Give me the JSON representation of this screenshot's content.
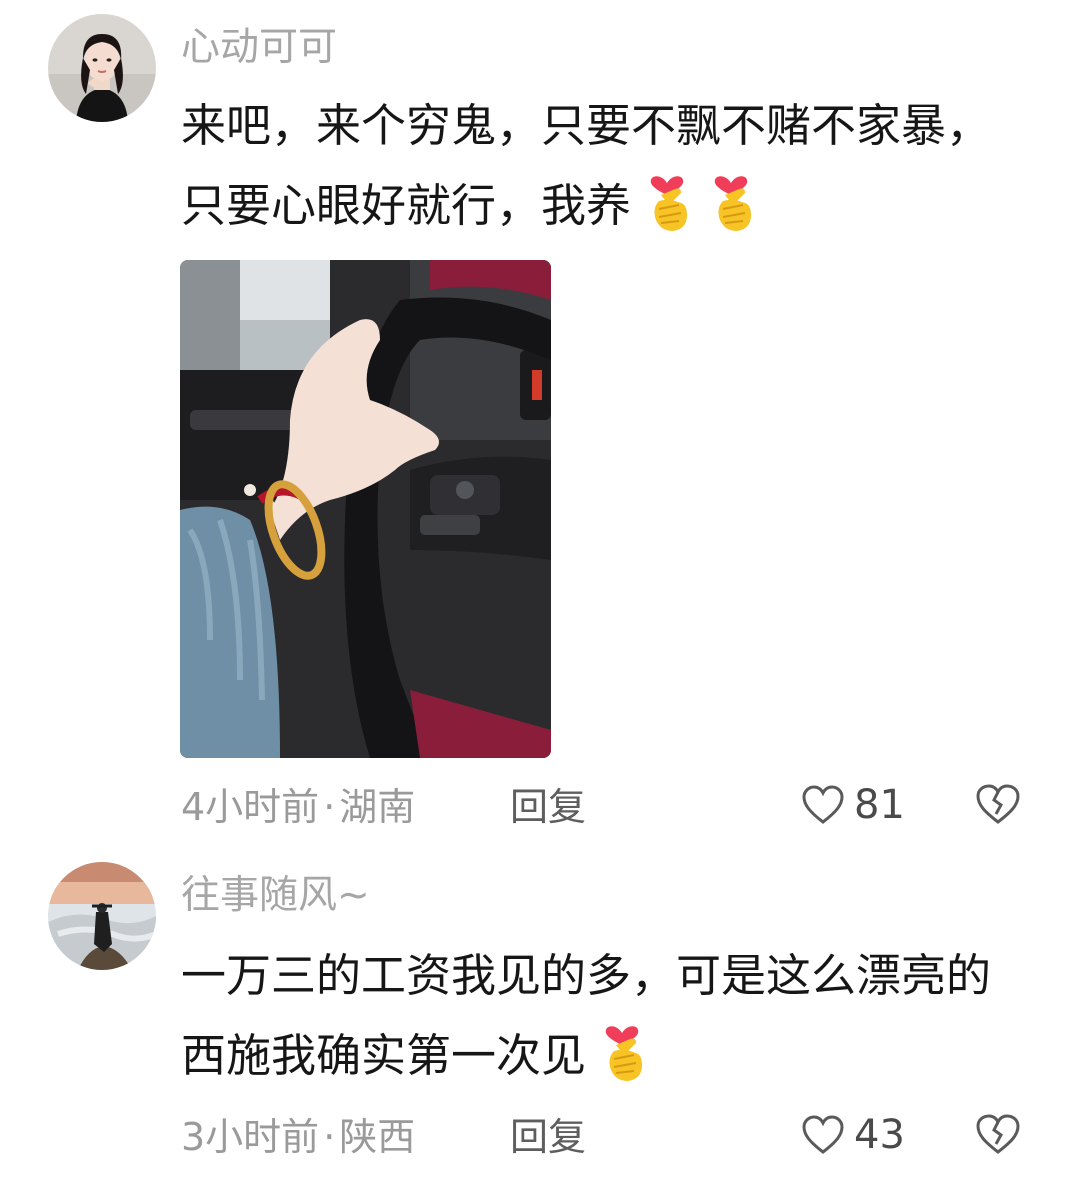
{
  "comments": [
    {
      "username": "心动可可",
      "text": "来吧，来个穷鬼，只要不飘不赌不家暴，只要心眼好就行，我养",
      "emoji": [
        "finger-heart-emoji",
        "finger-heart-emoji"
      ],
      "has_image": true,
      "time": "4小时前",
      "separator": "·",
      "location": "湖南",
      "reply_label": "回复",
      "likes": "81"
    },
    {
      "username": "往事随风~",
      "text": "一万三的工资我见的多，可是这么漂亮的西施我确实第一次见",
      "emoji": [
        "finger-heart-emoji"
      ],
      "has_image": false,
      "time": "3小时前",
      "separator": "·",
      "location": "陕西",
      "reply_label": "回复",
      "likes": "43"
    }
  ],
  "colors": {
    "username": "#a6a6a6",
    "text": "#161616",
    "meta": "#9a9a9a",
    "reply": "#5e5e5e",
    "icon": "#5a5a5a",
    "emoji_hand": "#f7c325",
    "emoji_heart": "#f03d5a"
  }
}
